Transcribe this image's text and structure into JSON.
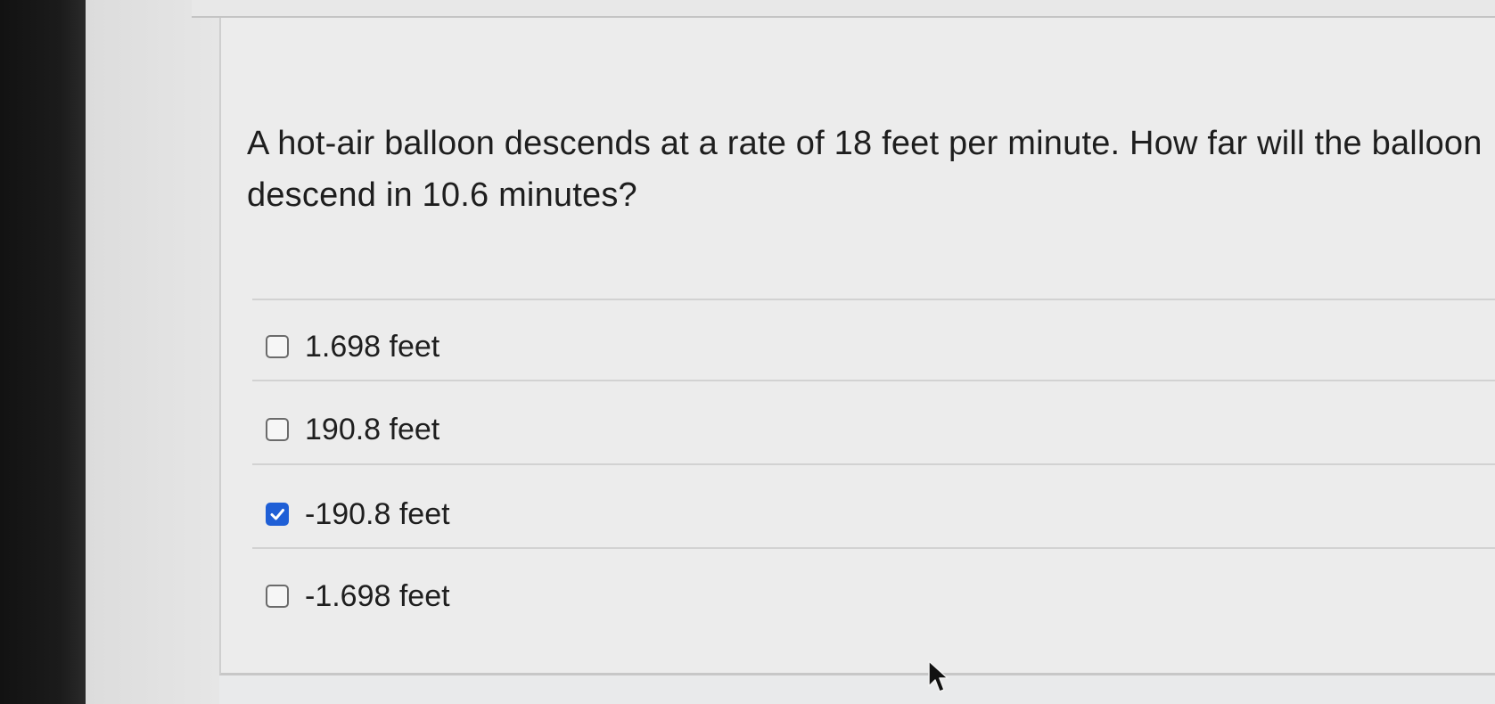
{
  "question": {
    "text": "A hot-air balloon descends at a rate of 18 feet per minute. How far will the balloon descend in 10.6 minutes?"
  },
  "choices": [
    {
      "label": "1.698 feet",
      "checked": false
    },
    {
      "label": "190.8 feet",
      "checked": false
    },
    {
      "label": "-190.8 feet",
      "checked": true
    },
    {
      "label": "-1.698 feet",
      "checked": false
    }
  ],
  "colors": {
    "checked_accent": "#1f5fd6",
    "text": "#1e1e1e"
  },
  "icons": {
    "checkbox_checked": "checkmark-icon",
    "cursor": "mouse-pointer-icon"
  }
}
